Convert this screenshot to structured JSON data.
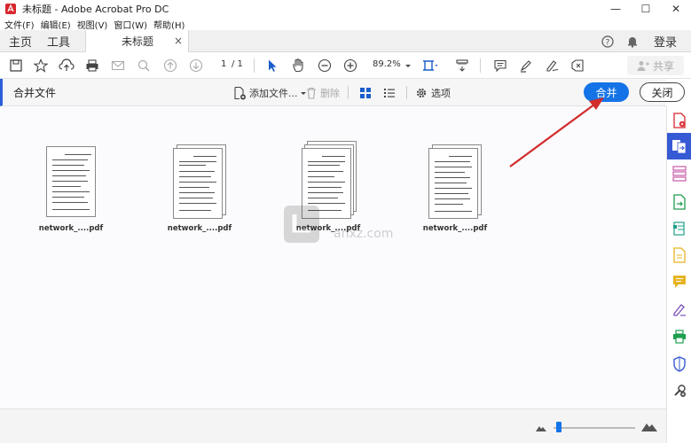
{
  "window": {
    "title": "未标题 - Adobe Acrobat Pro DC",
    "minimize": "—",
    "maximize": "☐",
    "close": "✕"
  },
  "menu": [
    "文件(F)",
    "编辑(E)",
    "视图(V)",
    "窗口(W)",
    "帮助(H)"
  ],
  "tabs": {
    "home": "主页",
    "tools": "工具",
    "document": "未标题",
    "close": "×"
  },
  "header": {
    "login": "登录"
  },
  "toolbar": {
    "current_page": "1",
    "page_total": "/ 1",
    "zoom": "89.2%",
    "share": "共享"
  },
  "combine": {
    "title": "合并文件",
    "add_files": "添加文件...",
    "delete": "删除",
    "options": "选项",
    "merge": "合并",
    "close": "关闭"
  },
  "files": [
    {
      "name": "network_....pdf"
    },
    {
      "name": "network_....pdf"
    },
    {
      "name": "network_....pdf"
    },
    {
      "name": "network_....pdf"
    }
  ],
  "watermark": {
    "text": "anxz.com"
  },
  "colors": {
    "accent": "#1473e6",
    "panel_active": "#3659d4",
    "arrow": "#d22b2b"
  }
}
